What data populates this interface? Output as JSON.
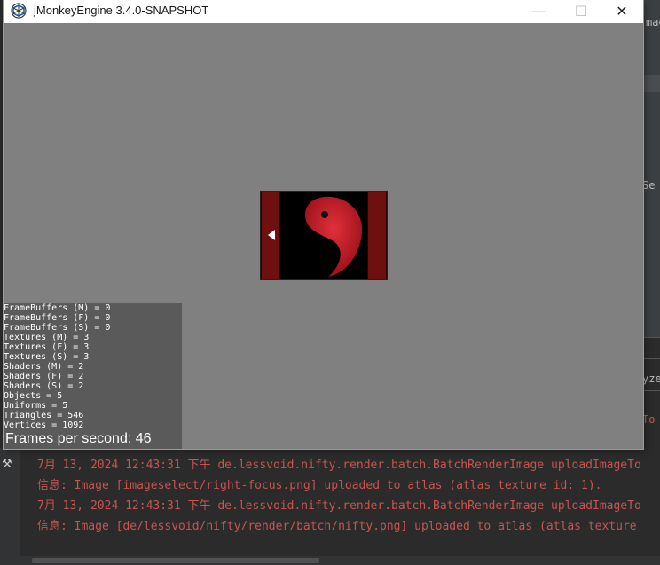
{
  "window": {
    "title": "jMonkeyEngine 3.4.0-SNAPSHOT",
    "controls": {
      "minimize": "—",
      "maximize": "☐",
      "close": "✕"
    }
  },
  "image_select": {
    "prev_arrow": "left-arrow",
    "logo_icon": "nifty-yin-logo"
  },
  "stats": {
    "rows": [
      "FrameBuffers (M) = 0",
      "FrameBuffers (F) = 0",
      "FrameBuffers (S) = 0",
      "Textures (M) = 3",
      "Textures (F) = 3",
      "Textures (S) = 3",
      "Shaders (M) = 2",
      "Shaders (F) = 2",
      "Shaders (S) = 2",
      "Objects = 5",
      "Uniforms = 5",
      "Triangles = 546",
      "Vertices = 1092"
    ],
    "fps": "Frames per second: 46"
  },
  "ide": {
    "fragments": {
      "mag": "mag",
      "se": "Se",
      "yze": "yze",
      "to": "To"
    },
    "console_lines": [
      "7月 13, 2024 12:43:31 下午 de.lessvoid.nifty.render.batch.BatchRenderImage uploadImageTo",
      "信息: Image [imageselect/right-focus.png] uploaded to atlas (atlas texture id: 1).",
      "7月 13, 2024 12:43:31 下午 de.lessvoid.nifty.render.batch.BatchRenderImage uploadImageTo",
      "信息: Image [de/lessvoid/nifty/render/batch/nifty.png] uploaded to atlas (atlas texture"
    ],
    "colors": {
      "console_text": "#c75450",
      "viewport_bg": "#808080",
      "stats_bg": "#5a5a5a",
      "selector_red": "#6e1010"
    }
  }
}
